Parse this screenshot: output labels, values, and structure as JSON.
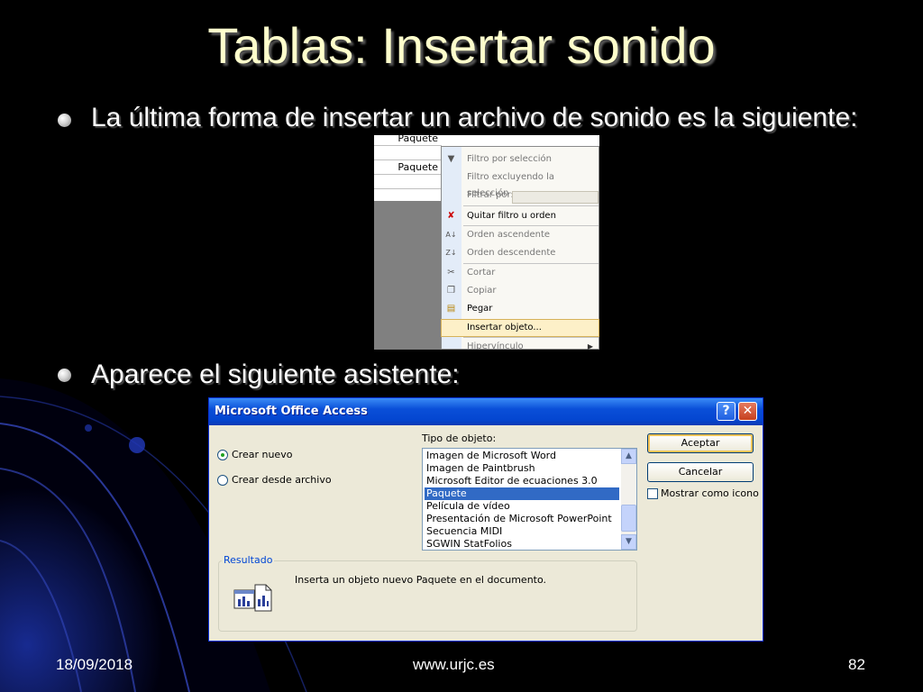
{
  "slide": {
    "title": "Tablas: Insertar sonido",
    "bullet1": "La última forma de insertar un archivo de sonido es la siguiente:",
    "bullet2": "Aparece el siguiente asistente:"
  },
  "context_menu": {
    "cells": [
      "Paquete",
      "",
      "Paquete",
      "",
      ""
    ],
    "items": [
      {
        "label": "Filtro por selección",
        "enabled": false,
        "icon": "filter-icon"
      },
      {
        "label": "Filtro excluyendo la selección",
        "enabled": false,
        "icon": ""
      },
      {
        "label": "Filtrar por:",
        "enabled": false,
        "icon": ""
      },
      {
        "label": "Quitar filtro u orden",
        "enabled": true,
        "icon": "remove-filter-icon"
      },
      {
        "label": "Orden ascendente",
        "enabled": false,
        "icon": "sort-ascending-icon"
      },
      {
        "label": "Orden descendente",
        "enabled": false,
        "icon": "sort-descending-icon"
      },
      {
        "label": "Cortar",
        "enabled": false,
        "icon": "cut-icon"
      },
      {
        "label": "Copiar",
        "enabled": false,
        "icon": "copy-icon"
      },
      {
        "label": "Pegar",
        "enabled": true,
        "icon": "paste-icon"
      },
      {
        "label": "Insertar objeto...",
        "enabled": true,
        "icon": "",
        "highlighted": true
      },
      {
        "label": "Hipervínculo",
        "enabled": false,
        "icon": "",
        "submenu": true
      }
    ]
  },
  "dialog": {
    "title": "Microsoft Office Access",
    "help_label": "?",
    "close_label": "✕",
    "radio_new": "Crear nuevo",
    "radio_file": "Crear desde archivo",
    "object_type_label": "Tipo de objeto:",
    "object_types": [
      "Imagen de Microsoft Word",
      "Imagen de Paintbrush",
      "Microsoft Editor de ecuaciones 3.0",
      "Paquete",
      "Película de vídeo",
      "Presentación de Microsoft PowerPoint",
      "Secuencia MIDI",
      "SGWIN StatFolios"
    ],
    "selected_object_type": "Paquete",
    "accept_label": "Aceptar",
    "cancel_label": "Cancelar",
    "show_icon_label": "Mostrar como icono",
    "result_label": "Resultado",
    "result_text": "Inserta un objeto nuevo Paquete en el documento."
  },
  "footer": {
    "date": "18/09/2018",
    "site": "www.urjc.es",
    "page": "82"
  }
}
